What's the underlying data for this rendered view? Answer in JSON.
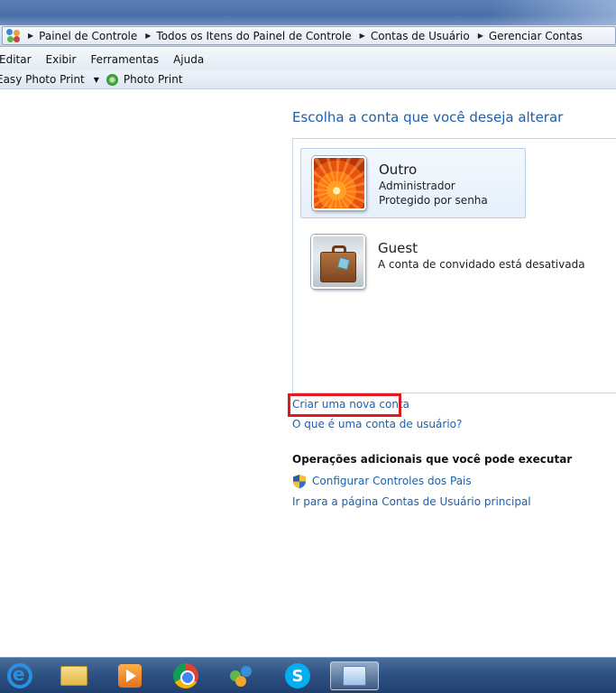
{
  "address": {
    "crumbs": [
      "Painel de Controle",
      "Todos os Itens do Painel de Controle",
      "Contas de Usuário",
      "Gerenciar Contas"
    ]
  },
  "menu": {
    "items": [
      "Editar",
      "Exibir",
      "Ferramentas",
      "Ajuda"
    ]
  },
  "toolbar": {
    "easy_photo_print": "Easy Photo Print",
    "photo_print": "Photo Print"
  },
  "main": {
    "heading": "Escolha a conta que você deseja alterar",
    "accounts": [
      {
        "name": "Outro",
        "line1": "Administrador",
        "line2": "Protegido por senha",
        "avatar": "orange-flower"
      },
      {
        "name": "Guest",
        "line1": "A conta de convidado está desativada",
        "avatar": "briefcase"
      }
    ],
    "create_link": "Criar uma nova conta",
    "what_is_link": "O que é uma conta de usuário?",
    "ops_title": "Operações adicionais que você pode executar",
    "parental_link": "Configurar Controles dos Pais",
    "main_page_link": "Ir para a página Contas de Usuário principal"
  },
  "highlight_color": "#e0191f",
  "link_color": "#1f5fa8",
  "taskbar": {
    "icons": [
      "internet-explorer-icon",
      "folder-icon",
      "media-player-icon",
      "chrome-icon",
      "messenger-icon",
      "skype-icon",
      "control-panel-icon"
    ]
  }
}
